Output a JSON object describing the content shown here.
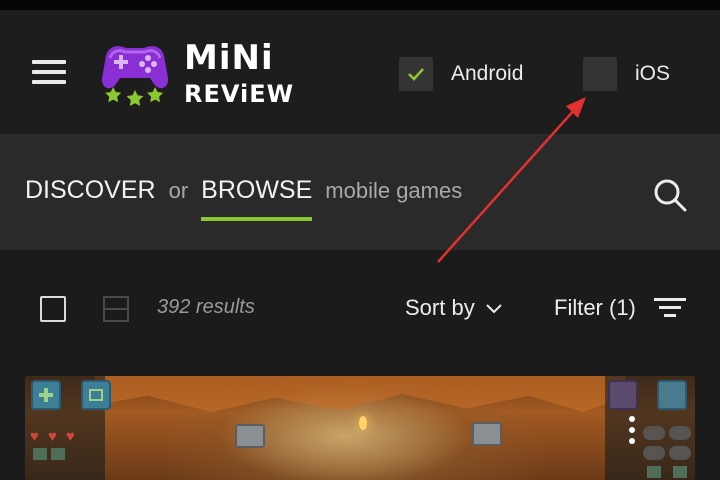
{
  "header": {
    "logo": {
      "line1": "MiNi",
      "line2": "REViEW",
      "colors": {
        "controller": "#8a2fd6",
        "stars": "#8bc72f"
      }
    },
    "platforms": [
      {
        "label": "Android",
        "checked": true
      },
      {
        "label": "iOS",
        "checked": false
      }
    ]
  },
  "discover": {
    "discover": "DISCOVER",
    "or": "or",
    "browse": "BROWSE",
    "suffix": "mobile games",
    "active_color": "#8bc72f"
  },
  "toolbar": {
    "results": "392 results",
    "sort": "Sort by",
    "filter": "Filter (1)"
  },
  "icons": [
    "menu-icon",
    "search-icon",
    "chevron-down-icon",
    "filter-lines-icon",
    "check-icon",
    "more-vertical-icon"
  ]
}
